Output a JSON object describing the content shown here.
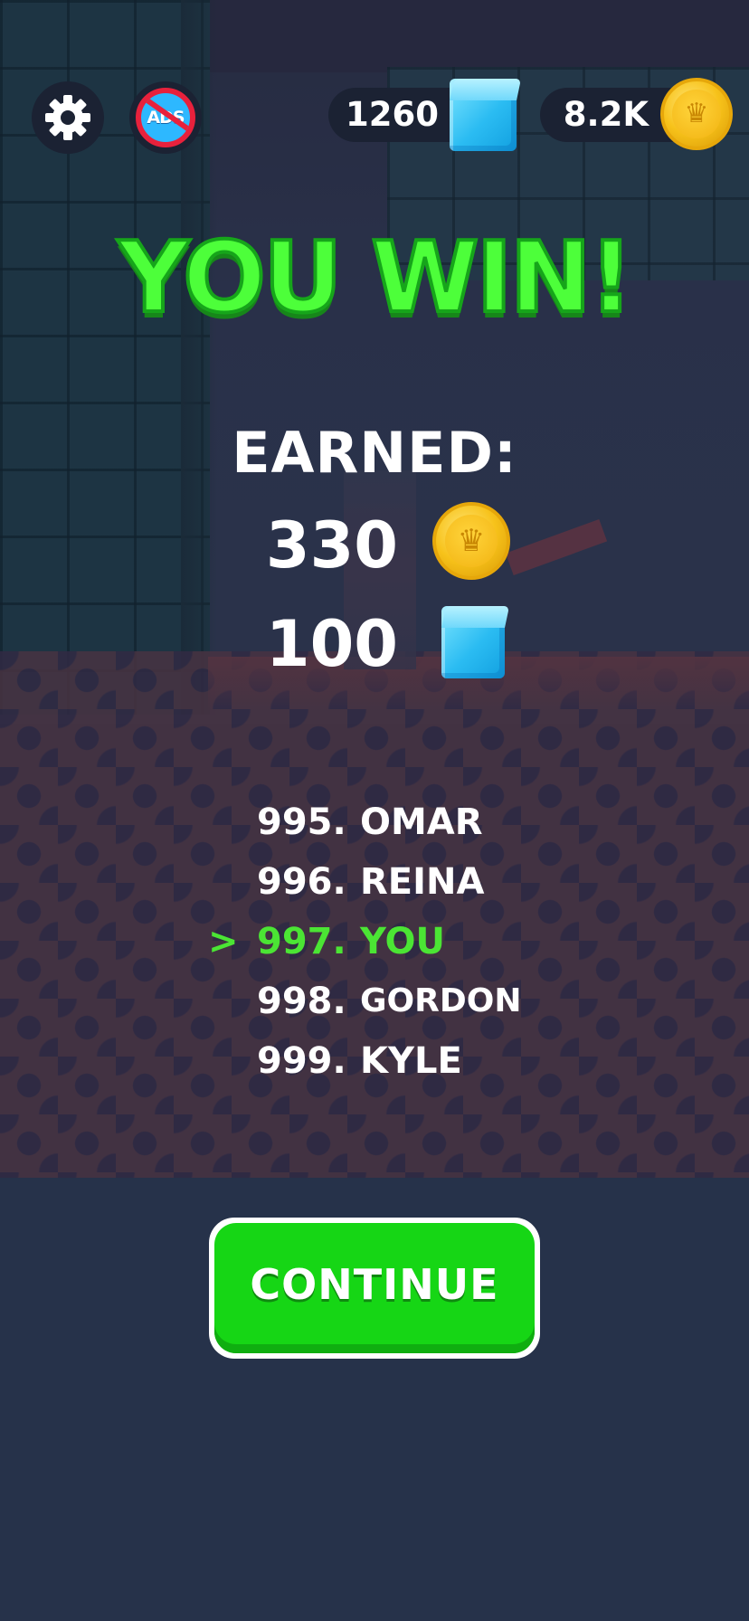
{
  "hud": {
    "settings_icon": "gear-icon",
    "no_ads_label": "ADS",
    "gems": "1260",
    "coins": "8.2K"
  },
  "result": {
    "title": "YOU WIN!",
    "earned_label": "EARNED:",
    "earned_coins": "330",
    "earned_gems": "100"
  },
  "leaderboard": {
    "rows": [
      {
        "rank": "995.",
        "name": "OMAR"
      },
      {
        "rank": "996.",
        "name": "REINA"
      },
      {
        "rank": "997.",
        "name": "YOU",
        "marker": ">"
      },
      {
        "rank": "998.",
        "name": "GORDON"
      },
      {
        "rank": "999.",
        "name": "KYLE"
      }
    ]
  },
  "continue_label": "CONTINUE",
  "colors": {
    "win_green": "#4dff3a",
    "button_green": "#16d615",
    "gem_blue": "#2bbcf2",
    "coin_gold": "#f7c21a",
    "hud_bg": "#1b2233"
  }
}
